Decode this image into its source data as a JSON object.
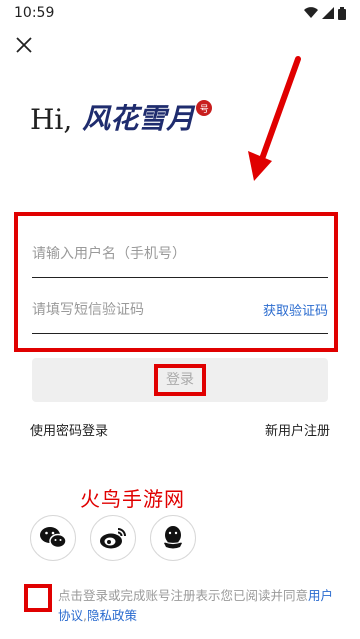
{
  "status_bar": {
    "time": "10:59"
  },
  "header": {
    "close_icon": "close-icon"
  },
  "logo": {
    "greeting": "Hi,",
    "brand": "风花雪月",
    "badge": "号"
  },
  "form": {
    "username_placeholder": "请输入用户名（手机号）",
    "code_placeholder": "请填写短信验证码",
    "get_code_label": "获取验证码"
  },
  "login": {
    "button_label": "登录"
  },
  "alt_links": {
    "password_login": "使用密码登录",
    "register": "新用户注册"
  },
  "watermark": "火鸟手游网",
  "social": [
    {
      "icon": "wechat-icon"
    },
    {
      "icon": "weibo-icon"
    },
    {
      "icon": "qq-icon"
    }
  ],
  "agreement": {
    "text": "点击登录或完成账号注册表示您已阅读并同意",
    "user_agreement": "用户协议",
    "separator": ",",
    "privacy_policy": "隐私政策"
  },
  "colors": {
    "annotation_red": "#e00000",
    "link_blue": "#2a6bcf",
    "brand_navy": "#1f2c6e"
  }
}
